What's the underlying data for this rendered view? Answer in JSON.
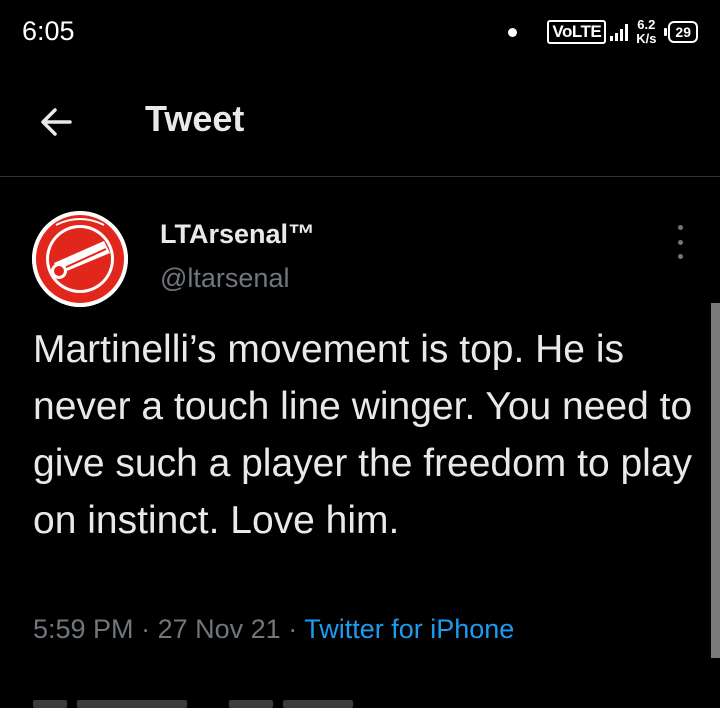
{
  "status_bar": {
    "time": "6:05",
    "network_type": "VoLTE",
    "speed_value": "6.2",
    "speed_unit": "K/s",
    "battery": "29"
  },
  "header": {
    "back_icon": "arrow-left-icon",
    "title": "Tweet"
  },
  "tweet": {
    "display_name": "LTArsenal™",
    "handle": "@ltarsenal",
    "avatar_icon": "ltarsenal-logo",
    "more_icon": "vertical-dots-icon",
    "text": "Martinelli’s movement is top. He is never a touch line winger. You need to give such a player the freedom to play on instinct. Love him.",
    "time": "5:59 PM",
    "separator": "·",
    "date": "27 Nov 21",
    "source": "Twitter for iPhone"
  },
  "colors": {
    "background": "#000000",
    "text_primary": "#e7e9ea",
    "text_secondary": "#71767b",
    "link": "#1d9bf0",
    "brand_red": "#e1261c"
  }
}
